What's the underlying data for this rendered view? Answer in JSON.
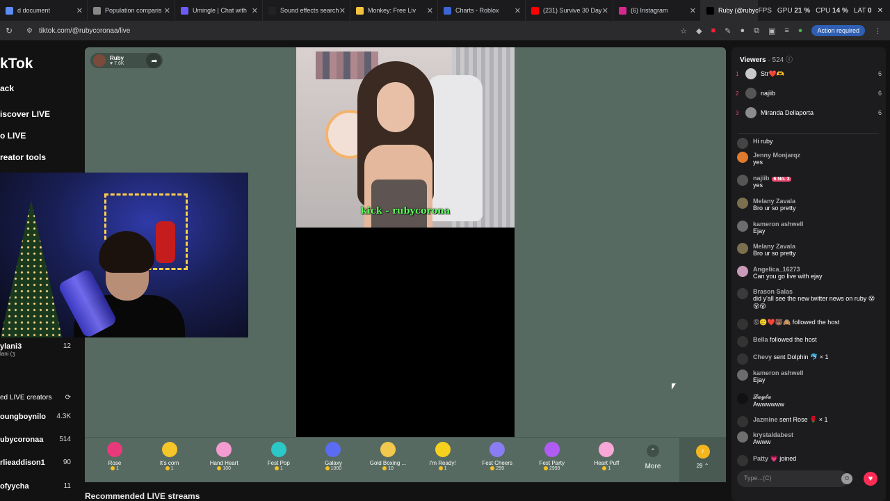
{
  "tabs": [
    {
      "label": "d document",
      "color": "#5c8df6"
    },
    {
      "label": "Population comparis",
      "color": "#888"
    },
    {
      "label": "Umingle | Chat with",
      "color": "#6a5cf6"
    },
    {
      "label": "Sound effects search",
      "color": "#222"
    },
    {
      "label": "Monkey: Free Liv",
      "color": "#f6c23e"
    },
    {
      "label": "Charts - Roblox",
      "color": "#3a66d6"
    },
    {
      "label": "(231) Survive 30 Day",
      "color": "#ff0000"
    },
    {
      "label": "(6) Instagram",
      "color": "#d6298f"
    },
    {
      "label": "Ruby (@rubyco",
      "color": "#000"
    }
  ],
  "sysmon": {
    "fps": "FPS",
    "gpu": "GPU",
    "gpu_val": "21 %",
    "cpu": "CPU",
    "cpu_val": "14 %",
    "lat": "LAT",
    "lat_val": "0"
  },
  "address": {
    "url": "tiktok.com/@rubycoronaa/live",
    "action_required": "Action required"
  },
  "left_nav": {
    "brand": "kTok",
    "items": [
      "ack",
      "iscover LIVE",
      "o LIVE",
      "reator tools"
    ],
    "section_title": "ed LIVE creators",
    "followed": {
      "name": "ylani3",
      "sub": "lani (ʒ",
      "count": "12"
    },
    "creators": [
      {
        "name": "oungboynilo",
        "count": "4.3K"
      },
      {
        "name": "ubycoronaa",
        "count": "514"
      },
      {
        "name": "rlieaddison1",
        "count": "90"
      },
      {
        "name": "ofyycha",
        "count": "11"
      }
    ]
  },
  "host": {
    "name": "Ruby",
    "likes": "♥ 7.6K"
  },
  "video": {
    "caption": "kick - rubycorona"
  },
  "gifts": [
    {
      "name": "Rose",
      "price": "1",
      "color": "#e8397b"
    },
    {
      "name": "It's corn",
      "price": "1",
      "color": "#f5c52a"
    },
    {
      "name": "Hand Heart",
      "price": "100",
      "color": "#f49bd1"
    },
    {
      "name": "Fest Pop",
      "price": "1",
      "color": "#2cc7c7"
    },
    {
      "name": "Galaxy",
      "price": "1000",
      "color": "#5b6cf2"
    },
    {
      "name": "Gold Boxing ...",
      "price": "10",
      "color": "#f2c94c"
    },
    {
      "name": "I'm Ready!",
      "price": "1",
      "color": "#f6d21f"
    },
    {
      "name": "Fest Cheers",
      "price": "299",
      "color": "#8a7cf2"
    },
    {
      "name": "Fest Party",
      "price": "2999",
      "color": "#b05cf2"
    },
    {
      "name": "Heart Puff",
      "price": "1",
      "color": "#f7a8d8"
    }
  ],
  "more_label": "More",
  "coin_balance": "29",
  "recommended": "Recommended LIVE streams",
  "viewers": {
    "title": "Viewers",
    "count": "· 524",
    "list": [
      {
        "rank": "1",
        "name": "Str❤️🫶",
        "score": "6",
        "color": "#c9c9c9"
      },
      {
        "rank": "2",
        "name": "najiib",
        "score": "6",
        "color": "#555"
      },
      {
        "rank": "3",
        "name": "Miranda Dellaporta",
        "score": "6",
        "color": "#8c8c8c"
      }
    ]
  },
  "chat": [
    {
      "kind": "msg",
      "who": "",
      "text": "Hi ruby",
      "color": "#444"
    },
    {
      "kind": "msg",
      "who": "Jenny Monjarqz",
      "text": "yes",
      "color": "#e07b2e"
    },
    {
      "kind": "msg",
      "who": "najiib",
      "badge": "6 No. 3",
      "text": "yes",
      "color": "#555"
    },
    {
      "kind": "msg",
      "who": "Melany Zavala",
      "text": "Bro ur so pretty",
      "color": "#7b6f4d"
    },
    {
      "kind": "msg",
      "who": "kameron ashwell",
      "text": "Ejay",
      "color": "#6c6c6c"
    },
    {
      "kind": "msg",
      "who": "Melany Zavala",
      "text": "Bro ur so pretty",
      "color": "#7b6f4d"
    },
    {
      "kind": "msg",
      "who": "Angelica_16273",
      "text": "Can you go live with ejay",
      "color": "#c89ab7"
    },
    {
      "kind": "msg",
      "who": "Brason Salas",
      "text": "did y'all see the new twitter news on ruby 😵😵😵",
      "color": "#3a3a3a"
    },
    {
      "kind": "event",
      "who": "😡🥲❤️🐻🙈",
      "text": "followed the host",
      "color": "#333"
    },
    {
      "kind": "event",
      "who": "Bella",
      "text": "followed the host",
      "color": "#333"
    },
    {
      "kind": "event",
      "who": "Chevy",
      "text": "sent Dolphin 🐬 × 1",
      "color": "#333"
    },
    {
      "kind": "msg",
      "who": "kameron ashwell",
      "text": "Ejay",
      "color": "#6c6c6c"
    },
    {
      "kind": "msg",
      "who": "𝓛𝓪𝔂𝓵𝓪",
      "text": "Awwwwww",
      "color": "#111"
    },
    {
      "kind": "event",
      "who": "Jazmine",
      "text": "sent Rose 🌹 × 1",
      "color": "#333"
    },
    {
      "kind": "msg",
      "who": "krystaldabest",
      "text": "Awww",
      "color": "#6f6f6f"
    },
    {
      "kind": "event",
      "who": "Patty 💗",
      "text": "joined",
      "color": "#333"
    }
  ],
  "chat_input": {
    "placeholder": "Type...(C)"
  }
}
